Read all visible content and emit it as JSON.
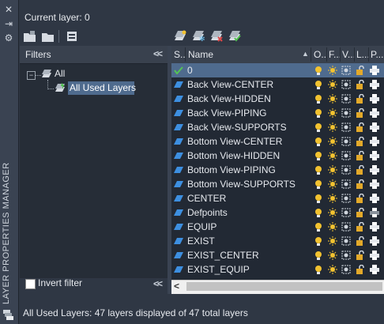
{
  "palette": {
    "title": "LAYER PROPERTIES MANAGER"
  },
  "header": {
    "current_layer": "Current layer: 0"
  },
  "filters": {
    "title": "Filters",
    "tree": {
      "root": "All",
      "child": "All Used Layers"
    },
    "invert_label": "Invert filter"
  },
  "grid": {
    "columns": [
      "S..",
      "Name",
      "O..",
      "F...",
      "V...",
      "L...",
      "P..."
    ],
    "rows": [
      {
        "name": "0",
        "current": true
      },
      {
        "name": "Back View-CENTER"
      },
      {
        "name": "Back View-HIDDEN"
      },
      {
        "name": "Back View-PIPING"
      },
      {
        "name": "Back View-SUPPORTS"
      },
      {
        "name": "Bottom View-CENTER"
      },
      {
        "name": "Bottom View-HIDDEN"
      },
      {
        "name": "Bottom View-PIPING"
      },
      {
        "name": "Bottom View-SUPPORTS"
      },
      {
        "name": "CENTER"
      },
      {
        "name": "Defpoints",
        "plot_disabled": true
      },
      {
        "name": "EQUIP"
      },
      {
        "name": "EXIST"
      },
      {
        "name": "EXIST_CENTER"
      },
      {
        "name": "EXIST_EQUIP"
      }
    ]
  },
  "status": "All Used Layers: 47 layers displayed of 47 total layers",
  "colors": {
    "selection": "#4f6b8e",
    "bulb": "#f2c230",
    "lock": "#e3a92a",
    "status_blue": "#3d8fe0"
  }
}
